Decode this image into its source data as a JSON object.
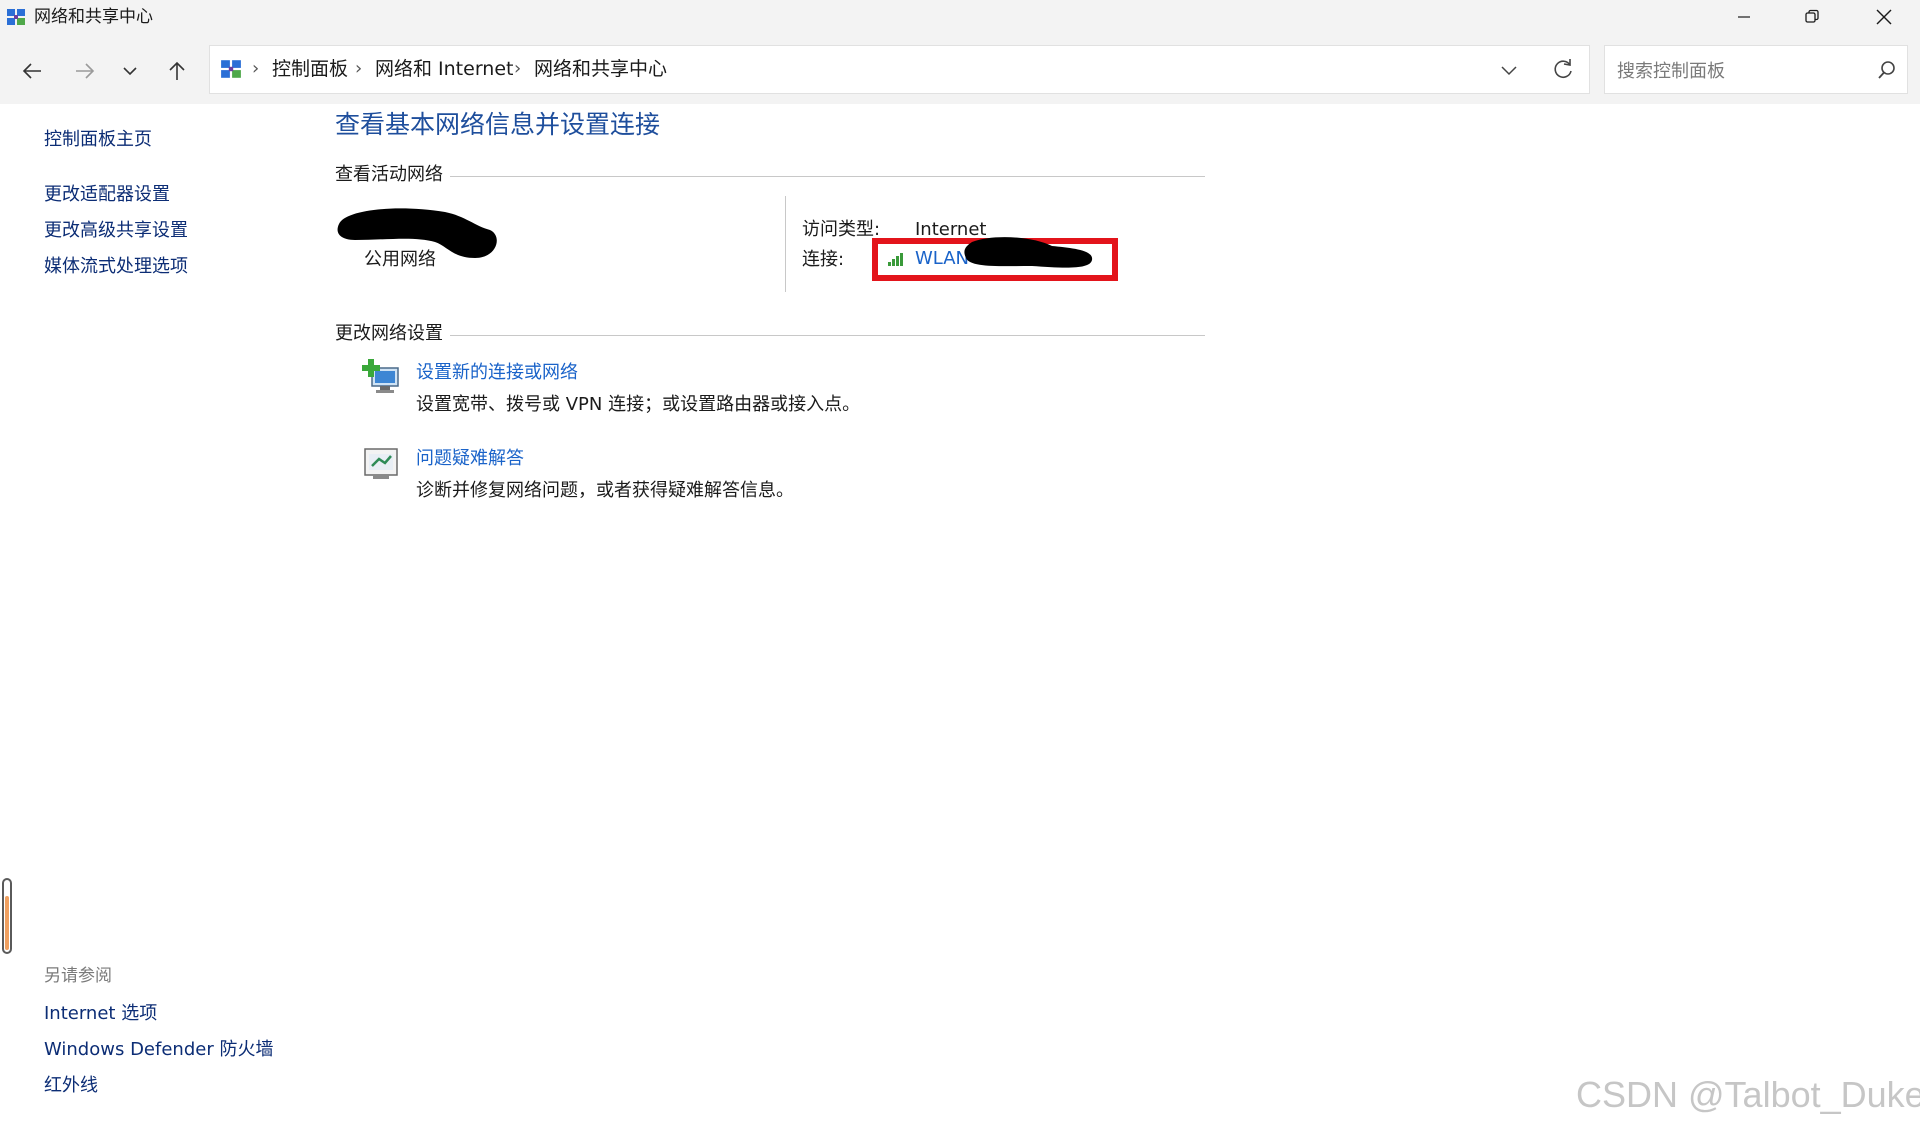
{
  "window": {
    "title": "网络和共享中心",
    "controls": [
      "minimize",
      "restore",
      "close"
    ]
  },
  "nav": {
    "breadcrumb": [
      "控制面板",
      "网络和 Internet",
      "网络和共享中心"
    ],
    "search_placeholder": "搜索控制面板"
  },
  "sidebar": {
    "home": "控制面板主页",
    "items": [
      "更改适配器设置",
      "更改高级共享设置",
      "媒体流式处理选项"
    ],
    "see_also_title": "另请参阅",
    "see_also": [
      "Internet 选项",
      "Windows Defender 防火墙",
      "红外线"
    ]
  },
  "main": {
    "title": "查看基本网络信息并设置连接",
    "active_networks_title": "查看活动网络",
    "network_type": "公用网络",
    "access_type_label": "访问类型:",
    "access_type_value": "Internet",
    "connection_label": "连接:",
    "connection_value": "WLAN",
    "change_settings_title": "更改网络设置",
    "tasks": [
      {
        "icon": "new-connection-icon",
        "link": "设置新的连接或网络",
        "desc": "设置宽带、拨号或 VPN 连接；或设置路由器或接入点。"
      },
      {
        "icon": "troubleshoot-icon",
        "link": "问题疑难解答",
        "desc": "诊断并修复网络问题，或者获得疑难解答信息。"
      }
    ]
  },
  "watermark": "CSDN @Talbot_Duke",
  "colors": {
    "link": "#1a63c9",
    "title": "#1e4e9c",
    "highlight": "#e3141b",
    "chrome": "#f3f3f3"
  }
}
